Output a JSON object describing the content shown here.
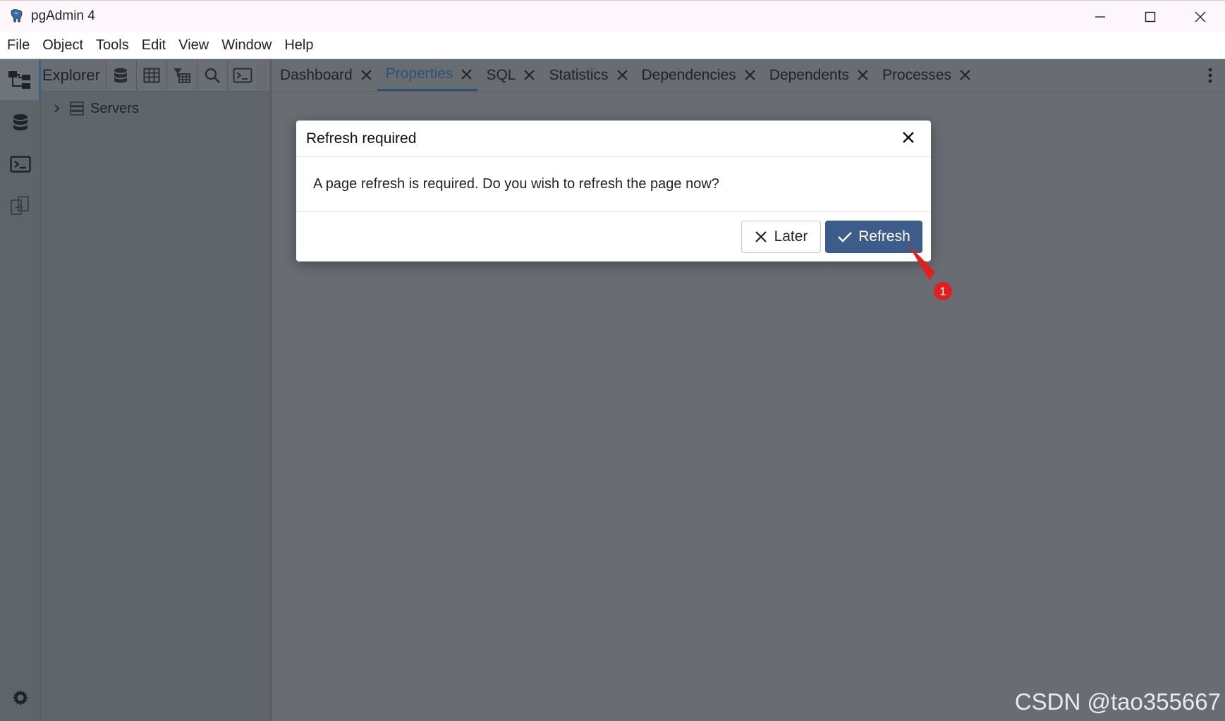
{
  "window": {
    "title": "pgAdmin 4"
  },
  "menu": [
    "File",
    "Object",
    "Tools",
    "Edit",
    "View",
    "Window",
    "Help"
  ],
  "explorer": {
    "title": "Explorer",
    "tree": [
      {
        "label": "Servers"
      }
    ]
  },
  "tabs": [
    {
      "label": "Dashboard",
      "active": false
    },
    {
      "label": "Properties",
      "active": true
    },
    {
      "label": "SQL",
      "active": false
    },
    {
      "label": "Statistics",
      "active": false
    },
    {
      "label": "Dependencies",
      "active": false
    },
    {
      "label": "Dependents",
      "active": false
    },
    {
      "label": "Processes",
      "active": false
    }
  ],
  "dialog": {
    "title": "Refresh required",
    "message": "A page refresh is required. Do you wish to refresh the page now?",
    "later_label": "Later",
    "refresh_label": "Refresh"
  },
  "annotation": {
    "badge": "1"
  },
  "watermark": "CSDN @tao355667",
  "colors": {
    "accent": "#3d5c8a",
    "overlay": "#696d73",
    "annotation": "#e02020"
  }
}
